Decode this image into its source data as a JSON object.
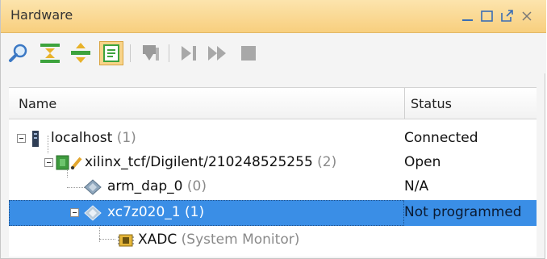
{
  "window": {
    "title": "Hardware"
  },
  "icons": {
    "minimize": "minimize-icon",
    "maximize": "maximize-icon",
    "float": "float-icon",
    "close": "close-icon",
    "search": "search-icon",
    "collapse_all": "collapse-all-icon",
    "expand_all": "expand-all-icon",
    "auto_connect": "auto-connect-icon",
    "program": "program-device-icon",
    "step": "step-icon",
    "run": "run-icon",
    "stop": "stop-icon"
  },
  "columns": {
    "name": "Name",
    "status": "Status"
  },
  "tree": [
    {
      "name": "localhost",
      "count": "(1)",
      "status": "Connected"
    },
    {
      "name": "xilinx_tcf/Digilent/210248525255",
      "count": "(2)",
      "status": "Open"
    },
    {
      "name": "arm_dap_0",
      "count": "(0)",
      "status": "N/A"
    },
    {
      "name": "xc7z020_1",
      "count": "(1)",
      "status": "Not programmed"
    },
    {
      "name": "XADC",
      "count": "(System Monitor)",
      "status": ""
    }
  ],
  "colors": {
    "selection": "#3a8ee6",
    "titlebar": "#f8cf7e"
  }
}
